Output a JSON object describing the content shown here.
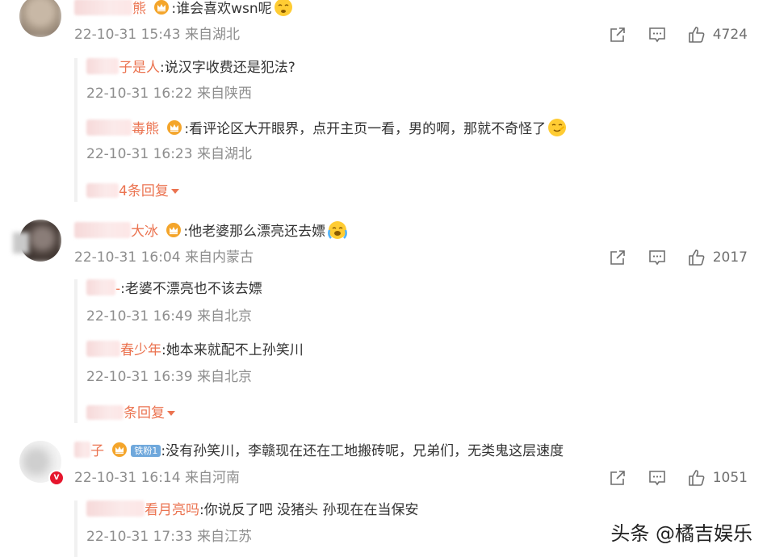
{
  "comments": [
    {
      "username_suffix": "熊",
      "text": ":谁会喜欢wsn呢",
      "meta": "22-10-31 15:43 来自湖北",
      "likes": "4724",
      "replies": [
        {
          "username_suffix": "子是人",
          "text": ":说汉字收费还是犯法?",
          "meta": "22-10-31 16:22 来自陕西"
        },
        {
          "username_suffix": "毒熊",
          "text": ":看评论区大开眼界，点开主页一看，男的啊，那就不奇怪了",
          "meta": "22-10-31 16:23 来自湖北"
        }
      ],
      "more_replies": "4条回复"
    },
    {
      "username_suffix": "大冰",
      "text": ":他老婆那么漂亮还去嫖",
      "meta": "22-10-31 16:04 来自内蒙古",
      "likes": "2017",
      "replies": [
        {
          "username_suffix": "-",
          "text": ":老婆不漂亮也不该去嫖",
          "meta": "22-10-31 16:49 来自北京"
        },
        {
          "username_suffix": "春少年",
          "text": ":她本来就配不上孙笑川",
          "meta": "22-10-31 16:39 来自北京"
        }
      ],
      "more_replies": "条回复"
    },
    {
      "username_suffix": "子",
      "fan_badge": "铁粉1",
      "text": ":没有孙笑川，李赣现在还在工地搬砖呢，兄弟们，无类鬼这层速度",
      "meta": "22-10-31 16:14 来自河南",
      "likes": "1051",
      "replies": [
        {
          "username_suffix": "看月亮吗",
          "text": ":你说反了吧 没猪头 孙现在在当保安",
          "meta": "22-10-31 17:33 来自江苏"
        }
      ]
    }
  ],
  "watermark": "头条 @橘吉娱乐",
  "colors": {
    "username": "#eb7350",
    "meta": "#8d8d8d",
    "text": "#333333"
  },
  "icons": [
    "share-icon",
    "comment-icon",
    "like-icon",
    "crown-icon",
    "verified-icon"
  ]
}
